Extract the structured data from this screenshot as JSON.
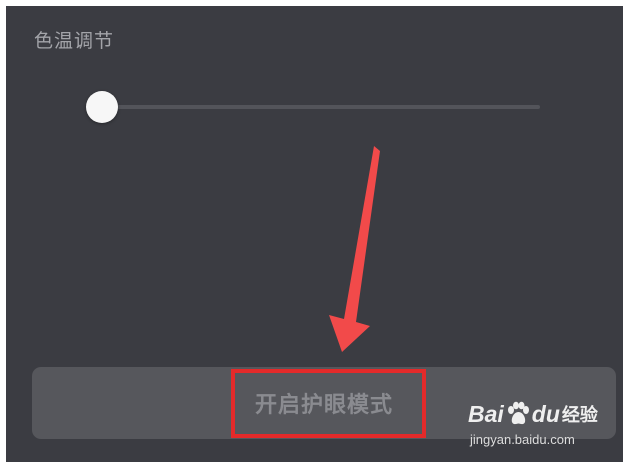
{
  "panel": {
    "section_title": "色温调节"
  },
  "color_temperature_slider": {
    "level": 0.0
  },
  "eye_protection_button": {
    "label": "开启护眼模式"
  },
  "annotation": {
    "arrow_color": "#f24a4a",
    "box_color": "#e42a2a"
  },
  "watermark": {
    "brand_prefix": "Bai",
    "brand_suffix": "du",
    "product": "经验",
    "url": "jingyan.baidu.com"
  },
  "icons": [
    "arrow-down-annotation-icon",
    "baidu-paw-icon"
  ]
}
